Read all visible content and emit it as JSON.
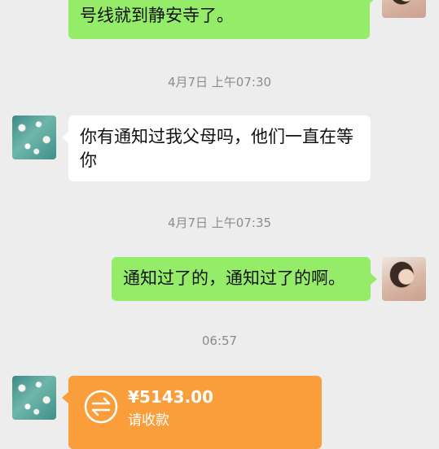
{
  "messages": {
    "top_green": "我现在正在九号线上，再坐两站转七号线就到静安寺了。",
    "ts1": "4月7日 上午07:30",
    "incoming1": "你有通知过我父母吗，他们一直在等你",
    "ts2": "4月7日 上午07:35",
    "outgoing2": "通知过了的，通知过了的啊。",
    "ts3": "06:57"
  },
  "transfer": {
    "amount": "¥5143.00",
    "label": "请收款"
  },
  "icons": {
    "left_avatar": "blossom-avatar",
    "right_avatar": "girl-avatar",
    "transfer_icon": "transfer-arrows-icon"
  },
  "colors": {
    "background": "#ededed",
    "incoming": "#ffffff",
    "outgoing": "#95ec69",
    "transfer": "#fa9d3b"
  }
}
